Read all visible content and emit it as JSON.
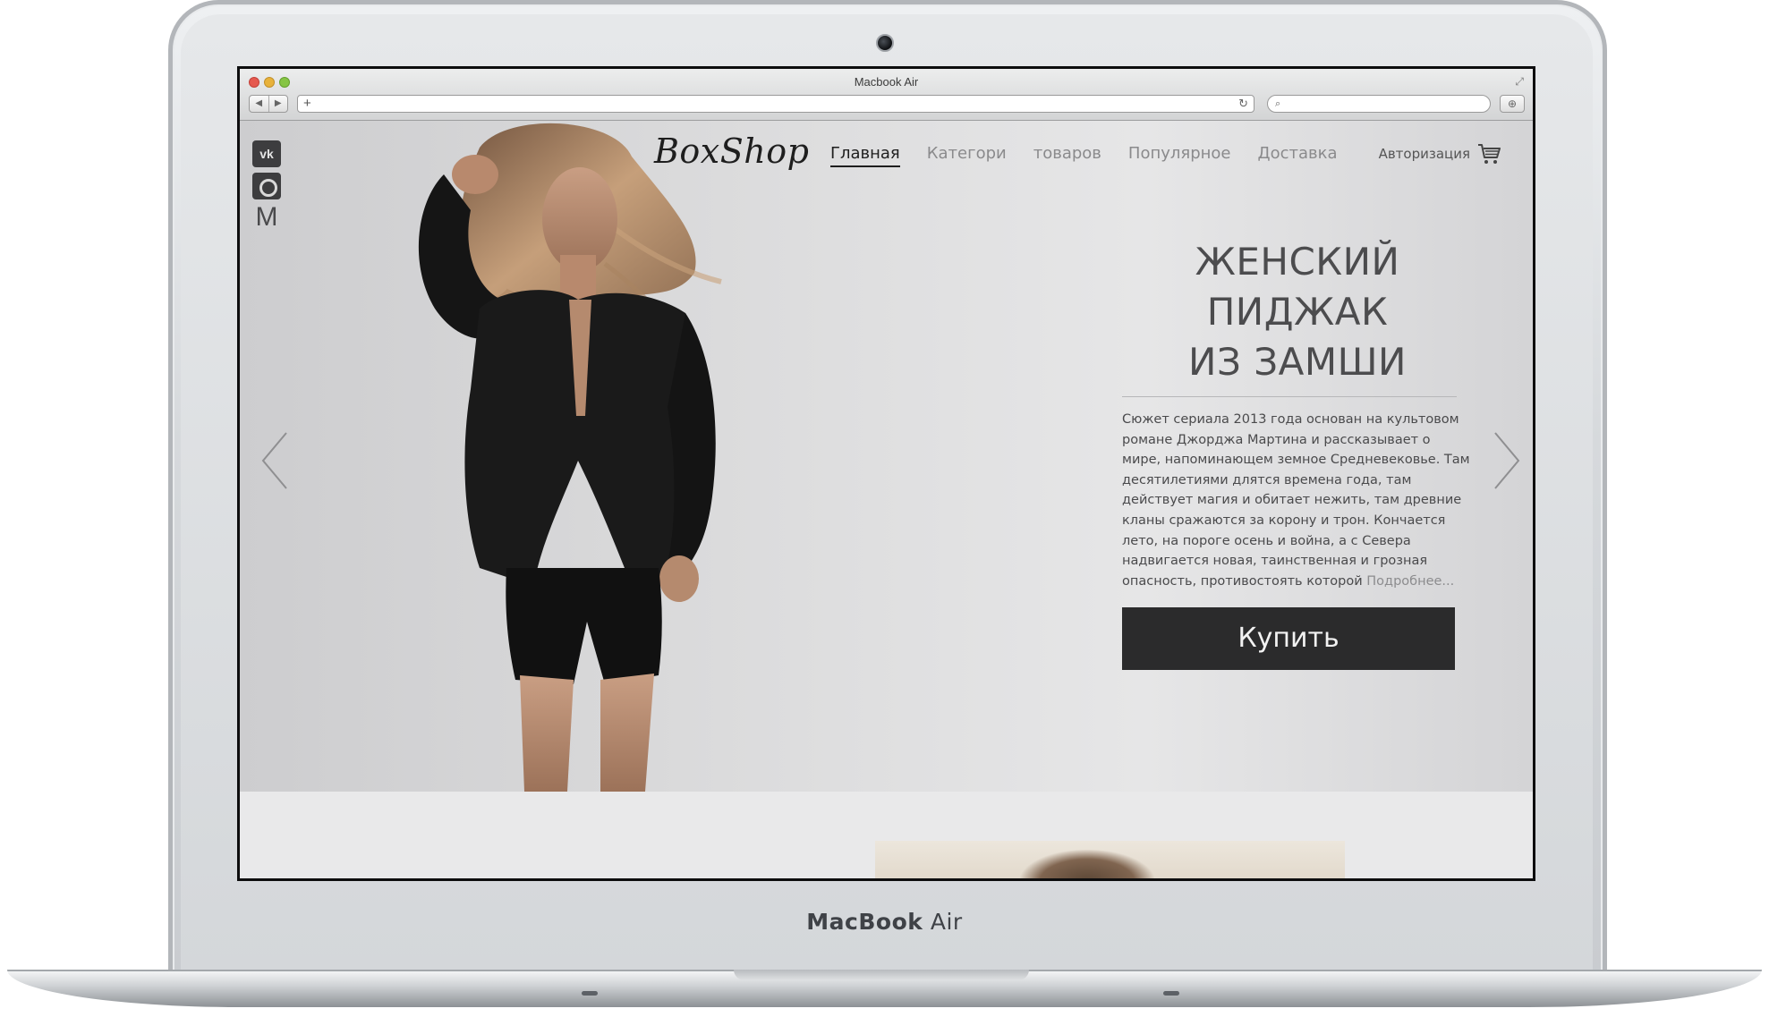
{
  "device": {
    "brand": "MacBook",
    "model": "Air"
  },
  "browser": {
    "window_title": "Macbook Air",
    "url": "",
    "search_placeholder": ""
  },
  "site": {
    "logo": "BoxShop",
    "nav": [
      {
        "label": "Главная",
        "active": true
      },
      {
        "label": "Категори",
        "active": false
      },
      {
        "label": "товаров",
        "active": false
      },
      {
        "label": "Популярное",
        "active": false
      },
      {
        "label": "Доставка",
        "active": false
      }
    ],
    "auth_label": "Авторизация",
    "social": [
      {
        "label": "vk",
        "icon": "vk-icon"
      },
      {
        "label": "",
        "icon": "instagram-icon"
      },
      {
        "label": "M",
        "icon": "gmail-icon"
      }
    ]
  },
  "hero": {
    "title_line1": "ЖЕНСКИЙ ПИДЖАК",
    "title_line2": "ИЗ ЗАМШИ",
    "description": "Сюжет сериала 2013 года основан на культовом романе Джорджа Мартина и рассказывает о мире, напоминающем земное Средневековье. Там десятилетиями длятся времена года, там действует магия и обитает нежить, там древние кланы сражаются за корону и трон. Кончается лето, на пороге осень и война, а с Севера надвигается новая, таинственная и грозная опасность, противостоять которой",
    "more_link": "Подробнее...",
    "buy_label": "Купить"
  },
  "colors": {
    "accent_dark": "#2b2b2c",
    "nav_inactive": "#8a8a8c",
    "text_main": "#4a4a4c"
  }
}
